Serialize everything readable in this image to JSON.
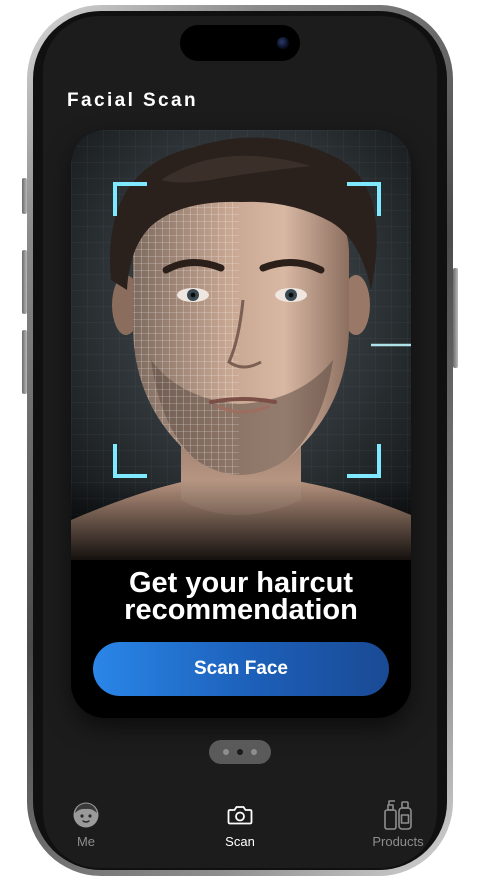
{
  "screen": {
    "title": "Facial Scan"
  },
  "hero": {
    "headline_line1": "Get your haircut",
    "headline_line2": "recommendation",
    "cta_label": "Scan Face"
  },
  "pager": {
    "count": 3,
    "active_index": 1
  },
  "tabs": [
    {
      "label": "Me",
      "icon": "face-icon",
      "active": false
    },
    {
      "label": "Scan",
      "icon": "camera-icon",
      "active": true
    },
    {
      "label": "Products",
      "icon": "bottles-icon",
      "active": false
    }
  ],
  "colors": {
    "background": "#1c1c1c",
    "button_gradient_start": "#2a86e8",
    "button_gradient_end": "#1a4a94",
    "scan_frame": "#7fe9ff",
    "tab_inactive": "#8e8e8e",
    "tab_active": "#ffffff"
  }
}
